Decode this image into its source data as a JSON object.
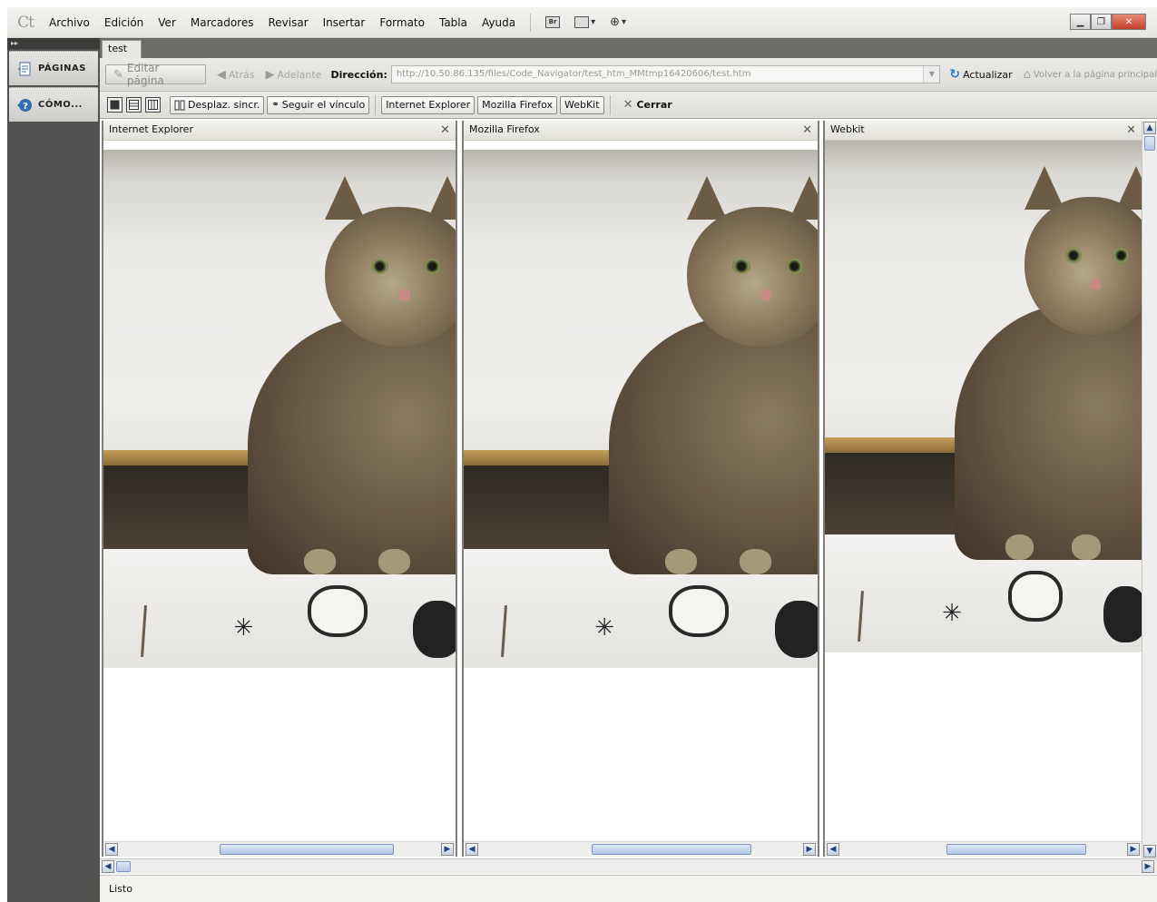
{
  "app": {
    "logo_text": "Ct"
  },
  "menu": {
    "items": [
      "Archivo",
      "Edición",
      "Ver",
      "Marcadores",
      "Revisar",
      "Insertar",
      "Formato",
      "Tabla",
      "Ayuda"
    ]
  },
  "left_panel": {
    "items": [
      {
        "label": "PÁGINAS",
        "icon": "pages-icon"
      },
      {
        "label": "CÓMO...",
        "icon": "help-icon"
      }
    ]
  },
  "document_tab": {
    "label": "test"
  },
  "address_bar": {
    "edit_page_label": "Editar página",
    "back_label": "Atrás",
    "forward_label": "Adelante",
    "address_label": "Dirección:",
    "address_value": "http://10.50.86.135/files/Code_Navigator/test_htm_MMtmp16420606/test.htm",
    "refresh_label": "Actualizar",
    "home_label": "Volver a la página principal"
  },
  "view_toolbar": {
    "sync_scroll_label": "Desplaz. sincr.",
    "follow_link_label": "Seguir el vínculo",
    "browser_buttons": [
      "Internet Explorer",
      "Mozilla Firefox",
      "WebKit"
    ],
    "close_label": "Cerrar"
  },
  "panes": [
    {
      "title": "Internet Explorer"
    },
    {
      "title": "Mozilla Firefox"
    },
    {
      "title": "Webkit"
    }
  ],
  "status": {
    "text": "Listo"
  },
  "colors": {
    "left_panel_bg": "#545250",
    "scroll_thumb": "#b6c7e6",
    "close_button": "#c3402a"
  }
}
